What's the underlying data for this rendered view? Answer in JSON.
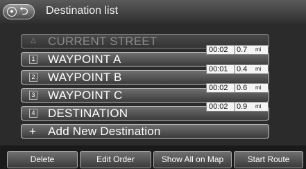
{
  "header": {
    "title": "Destination list",
    "voice_icon": "microphone-icon",
    "back_icon": "back-arrow-icon"
  },
  "list": {
    "items": [
      {
        "badge": "△",
        "label": "CURRENT STREET"
      },
      {
        "badge": "1",
        "label": "WAYPOINT A"
      },
      {
        "badge": "2",
        "label": "WAYPOINT B"
      },
      {
        "badge": "3",
        "label": "WAYPOINT C"
      },
      {
        "badge": "4",
        "label": "DESTINATION"
      }
    ],
    "add_label": "Add New Destination",
    "legs": [
      {
        "time": "00:02",
        "distance": "0.7",
        "unit": "mi"
      },
      {
        "time": "00:01",
        "distance": "0.4",
        "unit": "mi"
      },
      {
        "time": "00:02",
        "distance": "0.6",
        "unit": "mi"
      },
      {
        "time": "00:02",
        "distance": "0.9",
        "unit": "mi"
      }
    ]
  },
  "footer": {
    "delete": "Delete",
    "edit_order": "Edit Order",
    "show_all": "Show All on Map",
    "start_route": "Start Route"
  }
}
